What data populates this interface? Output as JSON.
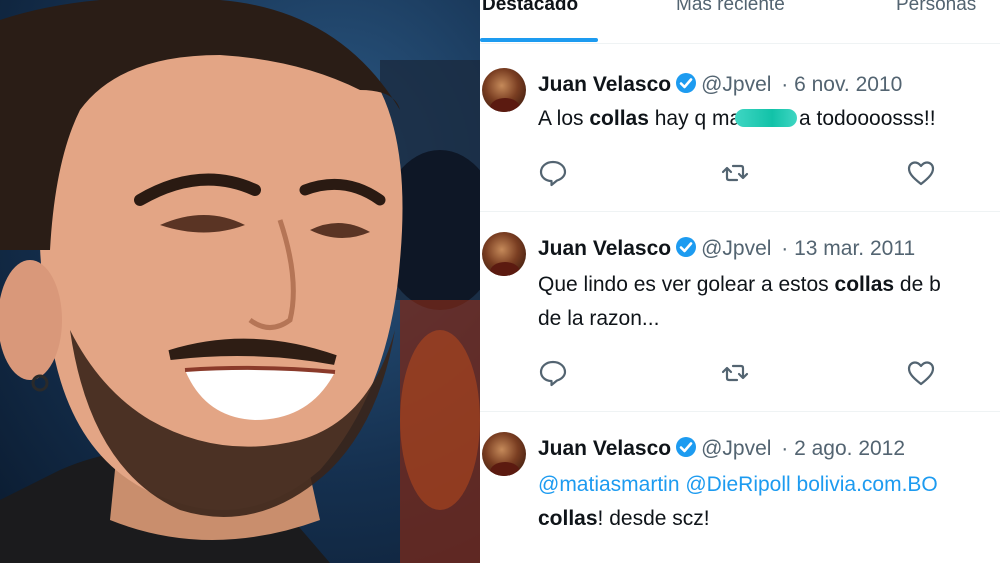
{
  "tabs": [
    {
      "label": "Destacado",
      "active": true
    },
    {
      "label": "Más reciente",
      "active": false
    },
    {
      "label": "Personas",
      "active": false
    }
  ],
  "colors": {
    "accent": "#1d9bf0",
    "text": "#0f1419",
    "muted": "#536471",
    "censor": "#12c2a8"
  },
  "tweets": [
    {
      "name": "Juan Velasco",
      "handle": "@Jpvel",
      "date": "· 6 nov. 2010",
      "text_a": "A los ",
      "highlight": "collas",
      "text_b": " hay q ma",
      "text_c": " a todoooosss!!"
    },
    {
      "name": "Juan Velasco",
      "handle": "@Jpvel",
      "date": "· 13 mar. 2011",
      "text_a": "Que lindo es ver golear a estos ",
      "highlight": "collas",
      "text_b": " de b\nde la razon..."
    },
    {
      "name": "Juan Velasco",
      "handle": "@Jpvel",
      "date": "· 2 ago. 2012",
      "mention_line": "@matiasmartin @DieRipoll bolivia.com.BO",
      "highlight": "collas",
      "text_b": "! desde scz!"
    }
  ],
  "icons": {
    "reply": "reply-icon",
    "retweet": "retweet-icon",
    "like": "heart-icon",
    "verified": "verified-badge-icon"
  }
}
